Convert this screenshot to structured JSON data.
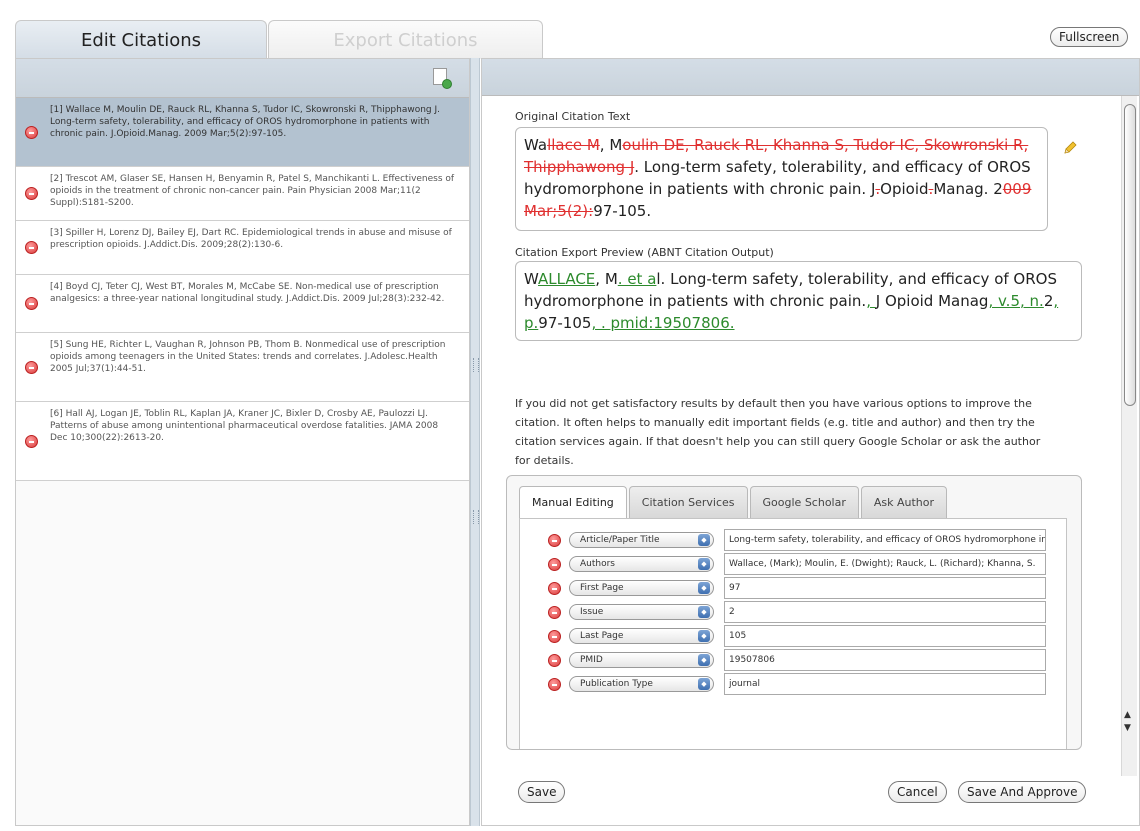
{
  "tabs": {
    "edit": "Edit Citations",
    "export": "Export Citations"
  },
  "fullscreen_label": "Fullscreen",
  "citations": [
    "[1] Wallace M, Moulin DE, Rauck RL, Khanna S, Tudor IC, Skowronski R, Thipphawong J. Long-term safety, tolerability, and efficacy of OROS hydromorphone in patients with chronic pain. J.Opioid.Manag. 2009 Mar;5(2):97-105.",
    "[2] Trescot AM, Glaser SE, Hansen H, Benyamin R, Patel S, Manchikanti L. Effectiveness of opioids in the treatment of chronic non-cancer pain. Pain Physician 2008 Mar;11(2 Suppl):S181-S200.",
    "[3] Spiller H, Lorenz DJ, Bailey EJ, Dart RC. Epidemiological trends in abuse and misuse of prescription opioids. J.Addict.Dis. 2009;28(2):130-6.",
    "[4] Boyd CJ, Teter CJ, West BT, Morales M, McCabe SE. Non-medical use of prescription analgesics: a three-year national longitudinal study. J.Addict.Dis. 2009 Jul;28(3):232-42.",
    "[5] Sung HE, Richter L, Vaughan R, Johnson PB, Thom B. Nonmedical use of prescription opioids among teenagers in the United States: trends and correlates. J.Adolesc.Health 2005 Jul;37(1):44-51.",
    "[6] Hall AJ, Logan JE, Toblin RL, Kaplan JA, Kraner JC, Bixler D, Crosby AE, Paulozzi LJ. Patterns of abuse among unintentional pharmaceutical overdose fatalities. JAMA 2008 Dec 10;300(22):2613-20."
  ],
  "original": {
    "label": "Original Citation Text",
    "segments": [
      {
        "t": "Wa",
        "k": "n"
      },
      {
        "t": "llace M",
        "k": "d"
      },
      {
        "t": ", M",
        "k": "n"
      },
      {
        "t": "oulin DE, Rauck RL, Khanna S, Tudor IC, Skowronski R, Thipphawong J",
        "k": "d"
      },
      {
        "t": ". Long-term safety, tolerability, and efficacy of OROS hydromorphone in patients with chronic pain. J",
        "k": "n"
      },
      {
        "t": ".",
        "k": "d"
      },
      {
        "t": "Opioid",
        "k": "n"
      },
      {
        "t": ".",
        "k": "d"
      },
      {
        "t": "Manag. 2",
        "k": "n"
      },
      {
        "t": "009 Mar;5(2):",
        "k": "d"
      },
      {
        "t": "97-105.",
        "k": "n"
      }
    ]
  },
  "preview": {
    "label": "Citation Export Preview (ABNT Citation Output)",
    "segments": [
      {
        "t": "W",
        "k": "n"
      },
      {
        "t": "ALLACE",
        "k": "i"
      },
      {
        "t": ", M",
        "k": "n"
      },
      {
        "t": ". et a",
        "k": "i"
      },
      {
        "t": "l. Long-term safety, tolerability, and efficacy of OROS hydromorphone in patients with chronic pain.",
        "k": "n"
      },
      {
        "t": ", ",
        "k": "i"
      },
      {
        "t": "J Opioid Manag",
        "k": "n"
      },
      {
        "t": ", v.",
        "k": "i"
      },
      {
        "t": "5",
        "k": "i"
      },
      {
        "t": ", n.",
        "k": "i"
      },
      {
        "t": "2",
        "k": "n"
      },
      {
        "t": ", p.",
        "k": "i"
      },
      {
        "t": "97-105",
        "k": "n"
      },
      {
        "t": ", . pmid:19507806.",
        "k": "i"
      }
    ]
  },
  "help_text": "If you did not get satisfactory results by default then you have various options to improve the citation. It often helps to manually edit important fields (e.g. title and author) and then try the citation services again. If that doesn't help you can still query Google Scholar or ask the author for details.",
  "sub_tabs": [
    "Manual Editing",
    "Citation Services",
    "Google Scholar",
    "Ask Author"
  ],
  "fields": [
    {
      "name": "Article/Paper Title",
      "value": "Long-term safety, tolerability, and efficacy of OROS hydromorphone in patients with chronic pain"
    },
    {
      "name": "Authors",
      "value": "Wallace, (Mark); Moulin, E. (Dwight); Rauck, L. (Richard); Khanna, S."
    },
    {
      "name": "First Page",
      "value": "97"
    },
    {
      "name": "Issue",
      "value": "2"
    },
    {
      "name": "Last Page",
      "value": "105"
    },
    {
      "name": "PMID",
      "value": "19507806"
    },
    {
      "name": "Publication Type",
      "value": "journal"
    }
  ],
  "buttons": {
    "save": "Save",
    "cancel": "Cancel",
    "save_approve": "Save And Approve"
  },
  "colors": {
    "deleted": "#e03030",
    "inserted": "#2c8a2c",
    "selected_row": "#b3c2d0",
    "header": "#d4dde6"
  }
}
